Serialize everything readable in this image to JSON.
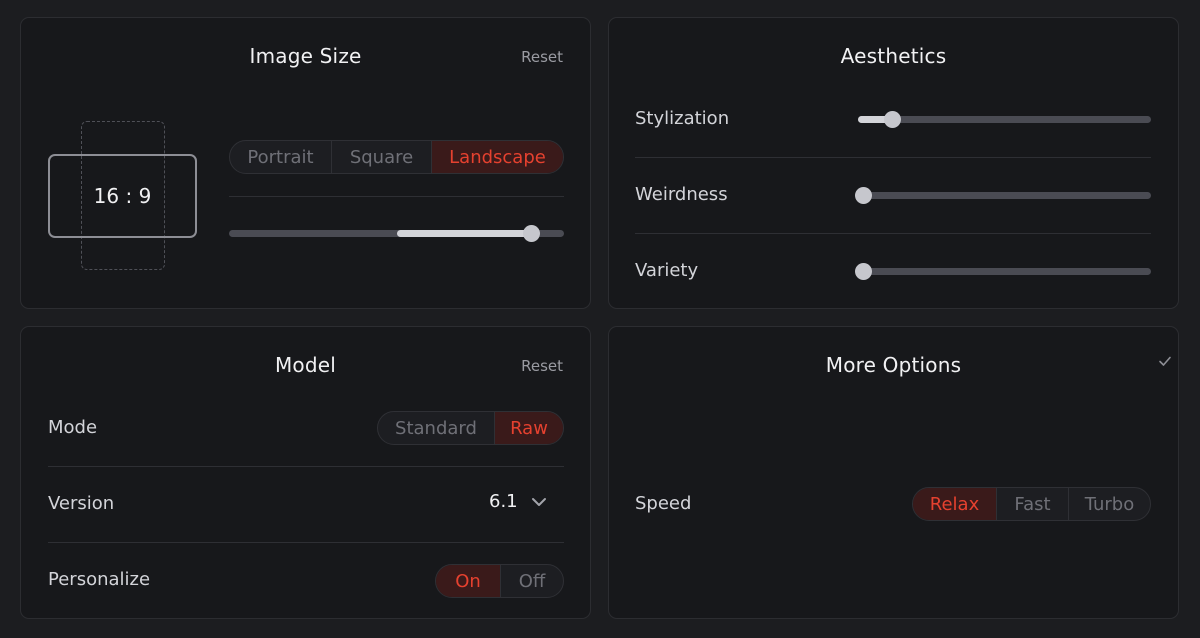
{
  "image_size": {
    "title": "Image Size",
    "reset_label": "Reset",
    "aspect_ratio": "16 : 9",
    "orientation_options": [
      "Portrait",
      "Square",
      "Landscape"
    ],
    "orientation_selected": "Landscape",
    "size_slider": {
      "range_start_fraction": 0.5,
      "range_end_fraction": 0.9
    }
  },
  "aesthetics": {
    "title": "Aesthetics",
    "rows": [
      {
        "label": "Stylization",
        "value_fraction": 0.1
      },
      {
        "label": "Weirdness",
        "value_fraction": 0.0
      },
      {
        "label": "Variety",
        "value_fraction": 0.0
      }
    ]
  },
  "model": {
    "title": "Model",
    "reset_label": "Reset",
    "mode_label": "Mode",
    "mode_options": [
      "Standard",
      "Raw"
    ],
    "mode_selected": "Raw",
    "version_label": "Version",
    "version_value": "6.1",
    "personalize_label": "Personalize",
    "personalize_options": [
      "On",
      "Off"
    ],
    "personalize_selected": "On"
  },
  "more_options": {
    "title": "More Options",
    "speed_label": "Speed",
    "speed_options": [
      "Relax",
      "Fast",
      "Turbo"
    ],
    "speed_selected": "Relax"
  },
  "icons": {
    "version_dropdown": "chevron-down-icon",
    "more_options_toggle": "checkmark-icon"
  },
  "colors": {
    "accent": "#e5412f",
    "accent_bg": "#3a1a1a",
    "panel_bg": "#17181b",
    "page_bg": "#1c1d20"
  }
}
